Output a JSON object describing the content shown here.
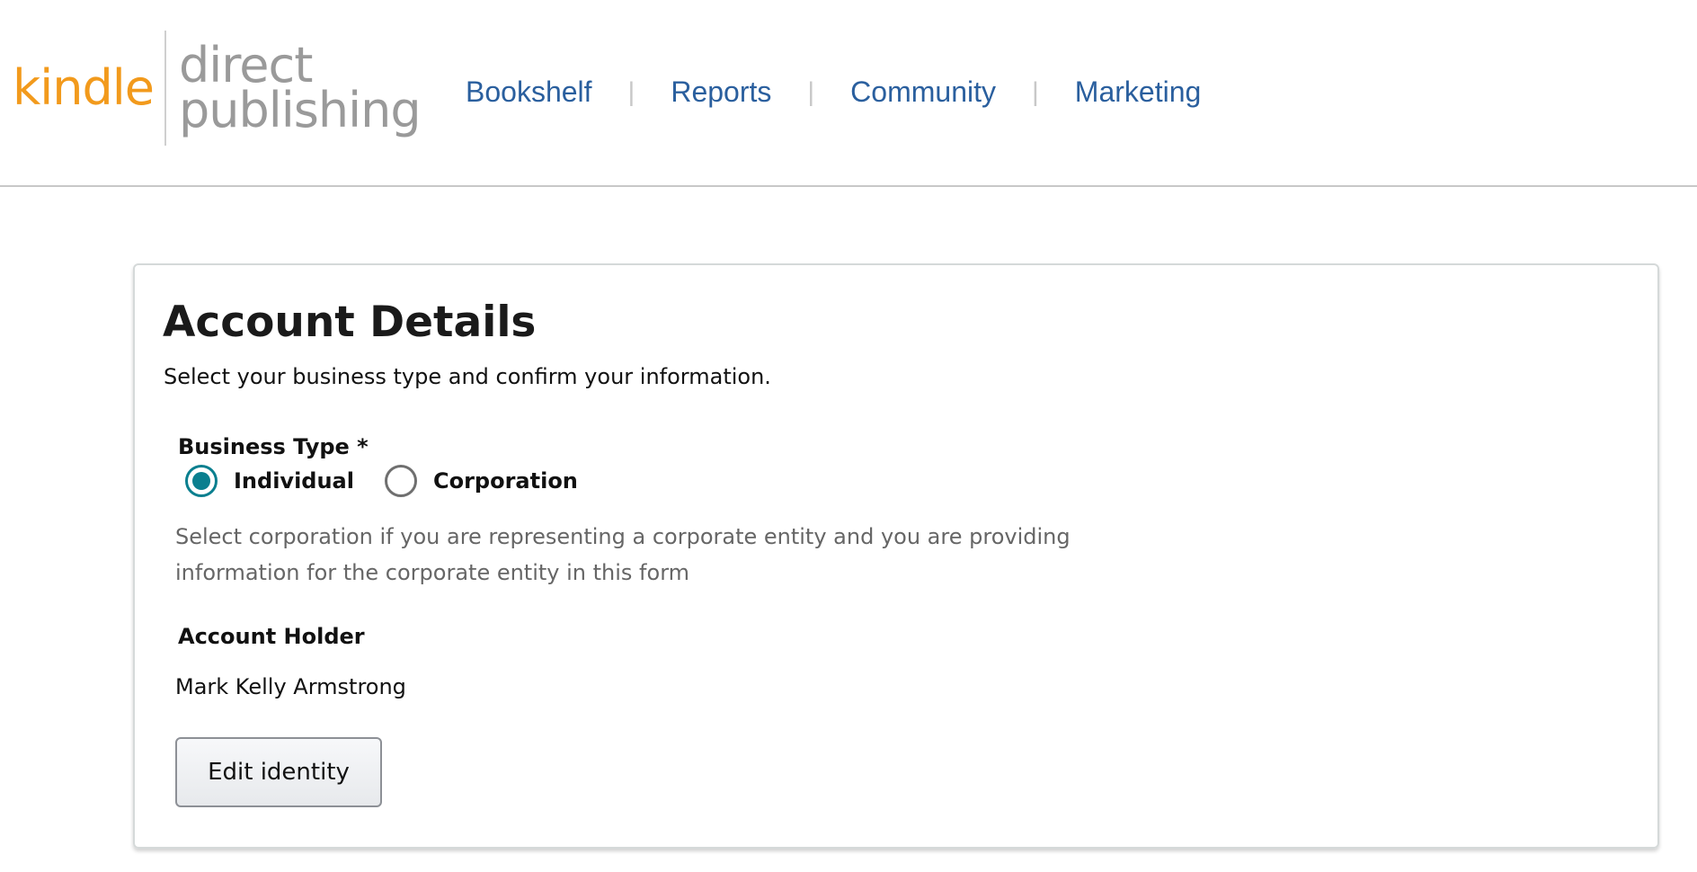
{
  "header": {
    "logo": {
      "kindle": "kindle",
      "direct": "direct",
      "publishing": "publishing"
    },
    "nav": {
      "bookshelf": "Bookshelf",
      "reports": "Reports",
      "community": "Community",
      "marketing": "Marketing",
      "separator": "|"
    }
  },
  "account_details": {
    "title": "Account Details",
    "subtitle": "Select your business type and confirm your information.",
    "business_type": {
      "label": "Business Type *",
      "options": [
        {
          "label": "Individual",
          "checked": true
        },
        {
          "label": "Corporation",
          "checked": false
        }
      ],
      "helper": "Select corporation if you are representing a corporate entity and you are providing information for the corporate entity in this form"
    },
    "account_holder": {
      "label": "Account Holder",
      "value": "Mark Kelly Armstrong"
    },
    "edit_button": "Edit identity"
  },
  "colors": {
    "brand_orange": "#f29a1c",
    "nav_link": "#2a5f9e",
    "radio_accent": "#0a7f8f"
  }
}
